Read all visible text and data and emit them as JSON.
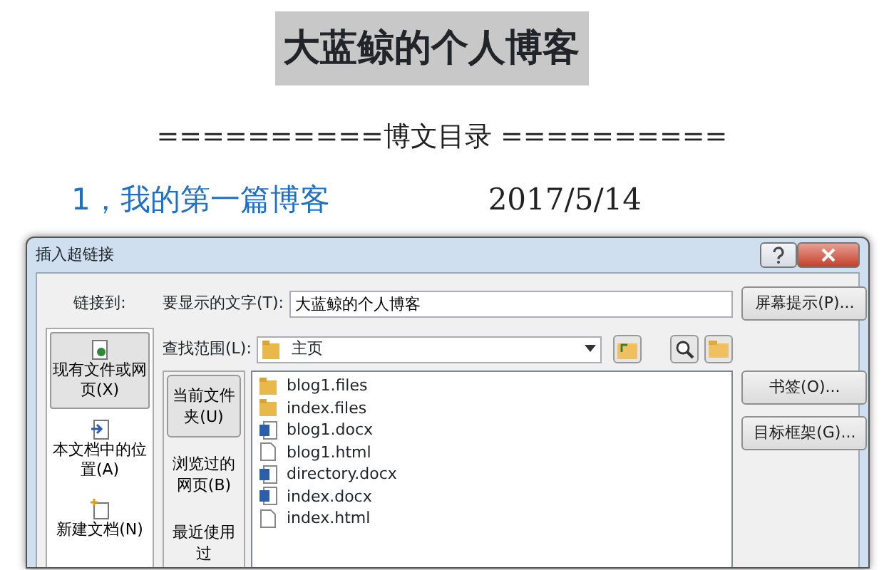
{
  "document": {
    "title": "大蓝鲸的个人博客",
    "toc_heading": "==========博文目录 ==========",
    "entries": [
      {
        "title": "1，我的第一篇博客",
        "date": "2017/5/14"
      }
    ]
  },
  "dialog": {
    "title": "插入超链接",
    "link_to_label": "链接到:",
    "link_to": [
      {
        "label": "现有文件或网页(X)",
        "kind": "file",
        "selected": true
      },
      {
        "label": "本文档中的位置(A)",
        "kind": "place",
        "selected": false
      },
      {
        "label": "新建文档(N)",
        "kind": "new",
        "selected": false
      }
    ],
    "display_text": {
      "label": "要显示的文字(T):",
      "value": "大蓝鲸的个人博客"
    },
    "screentip_button": "屏幕提示(P)...",
    "look_in": {
      "label": "查找范围(L):",
      "value": "主页"
    },
    "places": [
      {
        "label": "当前文件夹(U)",
        "selected": true
      },
      {
        "label": "浏览过的网页(B)",
        "selected": false
      },
      {
        "label": "最近使用过",
        "selected": false
      }
    ],
    "files": [
      {
        "name": "blog1.files",
        "kind": "folder"
      },
      {
        "name": "index.files",
        "kind": "folder"
      },
      {
        "name": "blog1.docx",
        "kind": "docx"
      },
      {
        "name": "blog1.html",
        "kind": "html"
      },
      {
        "name": "directory.docx",
        "kind": "docx"
      },
      {
        "name": "index.docx",
        "kind": "docx"
      },
      {
        "name": "index.html",
        "kind": "html"
      }
    ],
    "side_buttons": [
      "书签(O)...",
      "目标框架(G)..."
    ]
  }
}
